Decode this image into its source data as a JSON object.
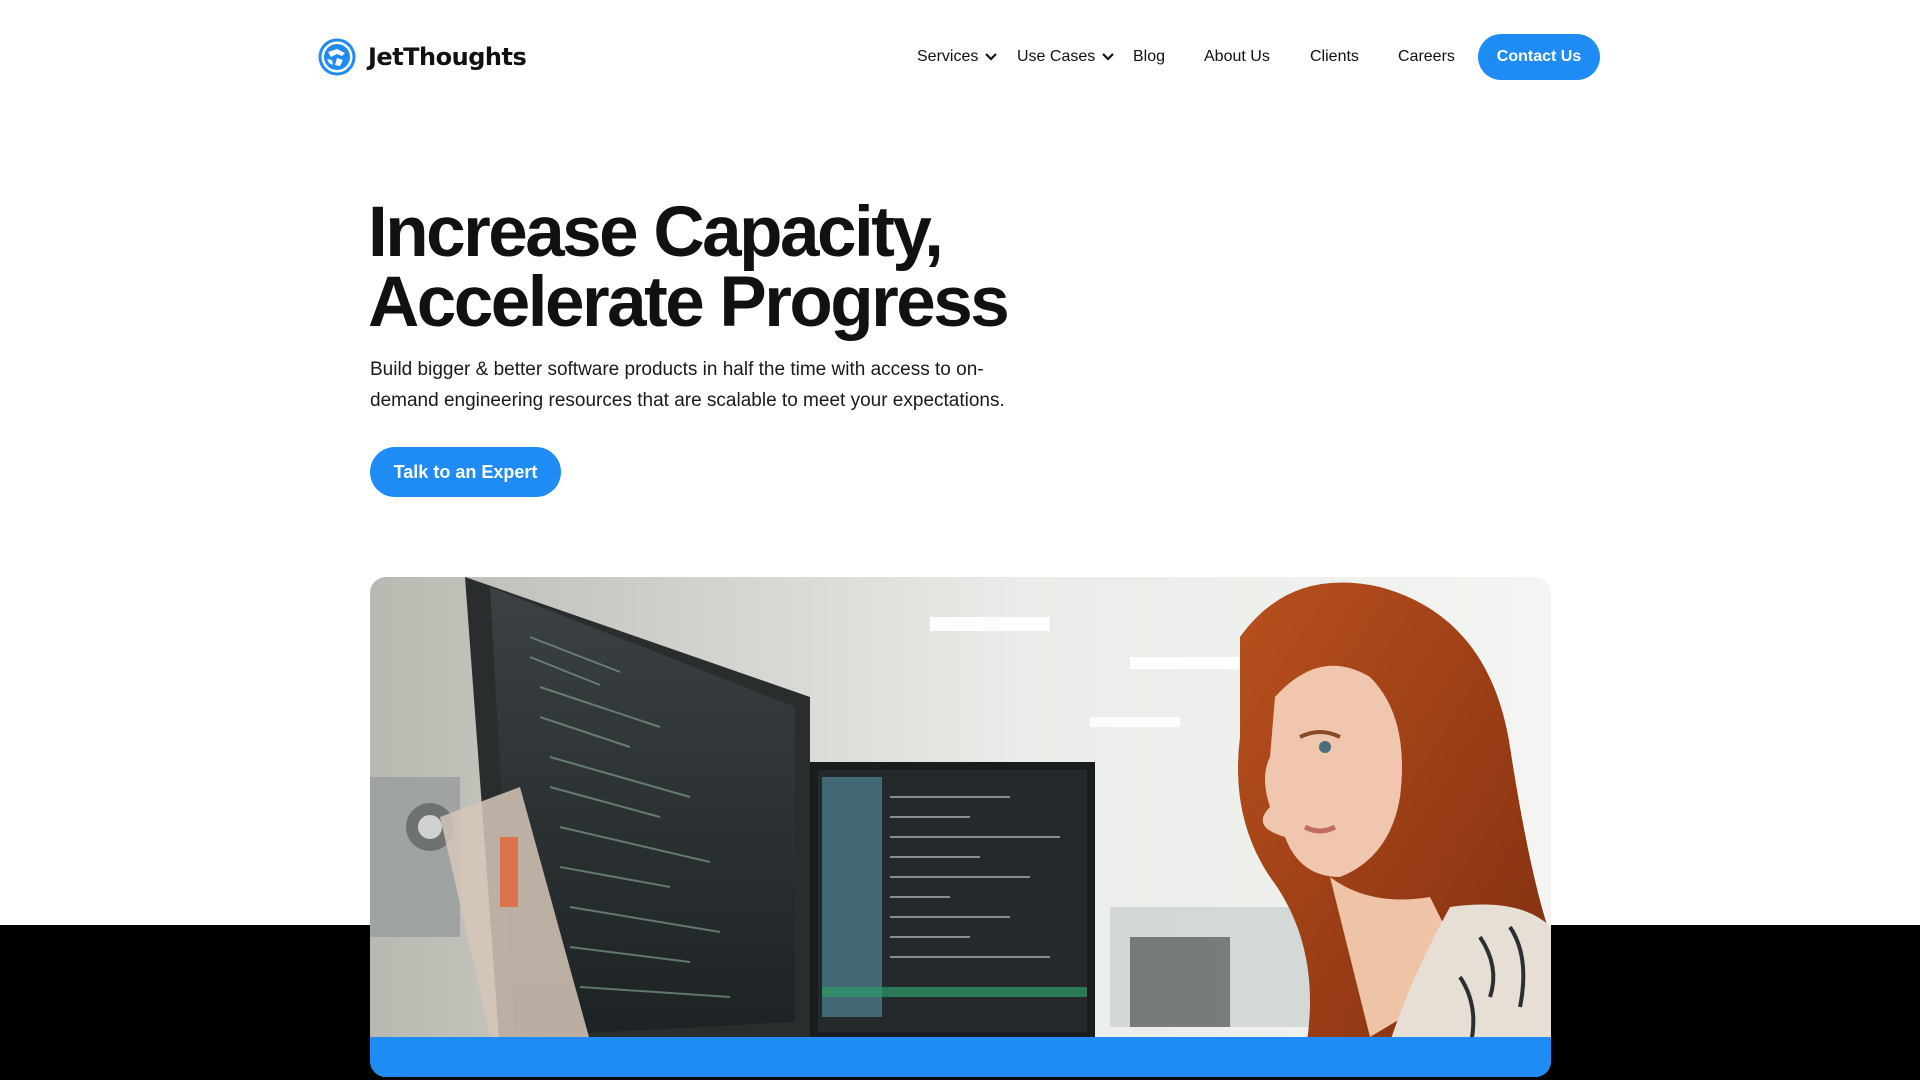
{
  "brand": {
    "name": "JetThoughts",
    "logo_icon": "globe-icon",
    "accent_color": "#1f8bf5"
  },
  "nav": {
    "items": [
      {
        "label": "Services",
        "has_dropdown": true
      },
      {
        "label": "Use Cases",
        "has_dropdown": true
      },
      {
        "label": "Blog",
        "has_dropdown": false
      },
      {
        "label": "About Us",
        "has_dropdown": false
      },
      {
        "label": "Clients",
        "has_dropdown": false
      },
      {
        "label": "Careers",
        "has_dropdown": false
      }
    ],
    "contact_label": "Contact Us"
  },
  "hero": {
    "title_line1": "Increase Capacity,",
    "title_line2": "Accelerate Progress",
    "subtitle": "Build bigger & better software products in half the time with access to on-demand engineering resources that are scalable to meet your expectations.",
    "cta_label": "Talk to an Expert"
  }
}
